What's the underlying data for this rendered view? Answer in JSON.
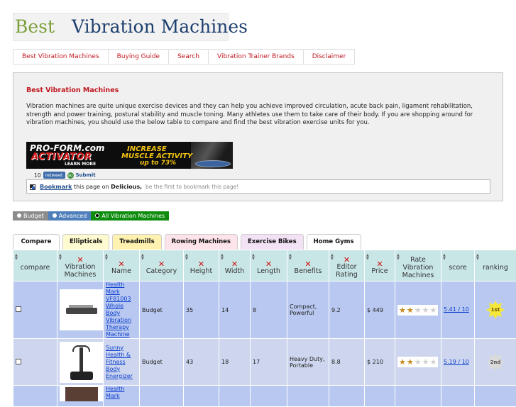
{
  "logo": {
    "word1": "Best",
    "word2": "Vibration Machines"
  },
  "nav": [
    "Best Vibration Machines",
    "Buying Guide",
    "Search",
    "Vibration Trainer Brands",
    "Disclaimer"
  ],
  "intro": {
    "title": "Best Vibration Machines",
    "text": "Vibration machines are quite unique exercise devices and they can help you achieve improved circulation, acute back pain, ligament rehabilitation, strength and power training, postural stability and muscle toning. Many athletes use them to take care of their body. If you are shopping around for vibration machines, you should use the below table to compare and find the best vibration exercise units for you."
  },
  "ad": {
    "brand": "PRO-FORM.com",
    "product": "ACTIVATOR",
    "learn_more": "LEARN MORE",
    "line1": "INCREASE",
    "line2": "MUSCLE ACTIVITY",
    "line3": "up to 73%"
  },
  "share": {
    "count": "10",
    "retweet": "retweet",
    "submit": "Submit"
  },
  "bookmark": {
    "link": "Bookmark",
    "mid": " this page on ",
    "site": "Delicious,",
    "note": "be the first to bookmark this page!"
  },
  "filters": [
    "Budget",
    "Advanced",
    "All Vibration Machines"
  ],
  "tabs": [
    "Compare",
    "Ellipticals",
    "Treadmills",
    "Rowing Machines",
    "Exercise Bikes",
    "Home Gyms"
  ],
  "table": {
    "headers": [
      "compare",
      "Vibration Machines",
      "Name",
      "Category",
      "Height",
      "Width",
      "Length",
      "Benefits",
      "Editor Rating",
      "Price",
      "Rate Vibration Machines",
      "score",
      "ranking"
    ],
    "rows": [
      {
        "name": "Health Mark VF81003 Whole Body Vibration Therapy Machine",
        "category": "Budget",
        "height": "35",
        "width": "14",
        "length": "8",
        "benefits": "Compact, Powerful",
        "editor_rating": "9.2",
        "price": "$ 449",
        "stars": 2,
        "score": "5.41 / 10",
        "ranking": "1st"
      },
      {
        "name": "Sunny Health & Fitness Body Energizer",
        "category": "Budget",
        "height": "43",
        "width": "18",
        "length": "17",
        "benefits": "Heavy Duty, Portable",
        "editor_rating": "8.8",
        "price": "$ 210",
        "stars": 2,
        "score": "5.19 / 10",
        "ranking": "2nd"
      },
      {
        "name": "Health Mark"
      }
    ]
  },
  "colors": {
    "accent_red": "#c0171f",
    "logo_green": "#7ba03a",
    "logo_blue": "#1d3f6e",
    "header_bg": "#c9e6e6",
    "row_bg": "#b9c8f0"
  }
}
